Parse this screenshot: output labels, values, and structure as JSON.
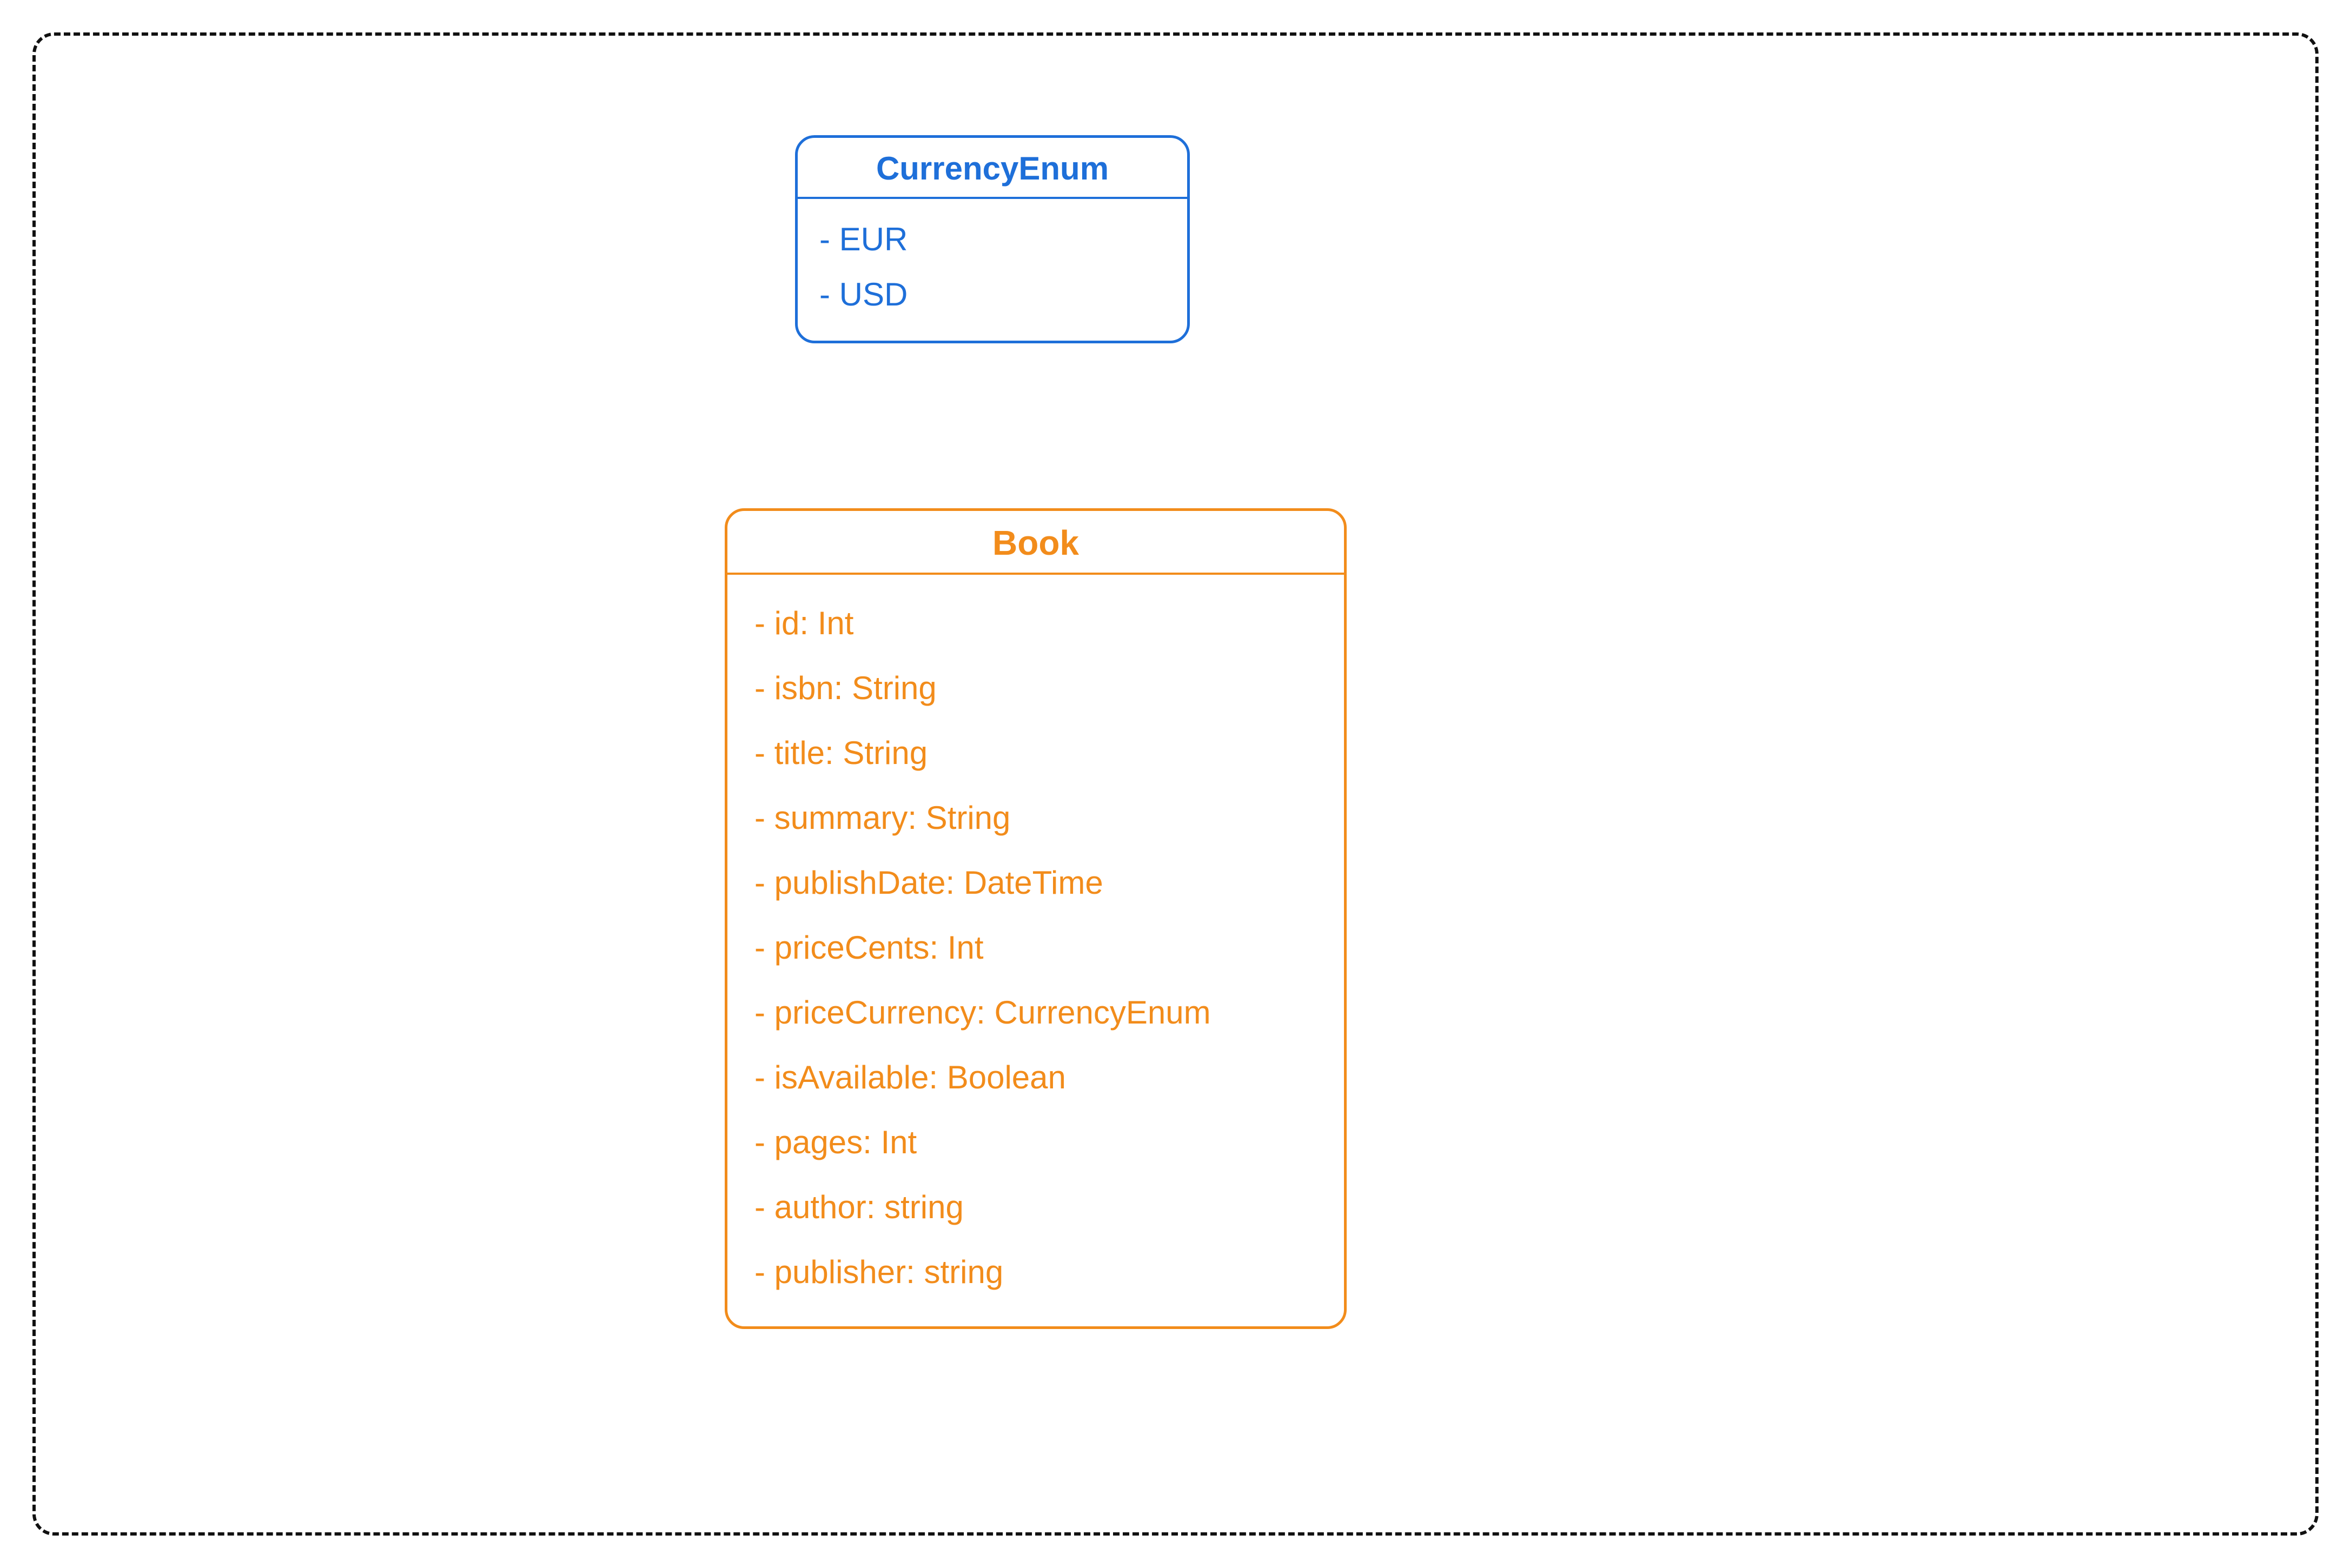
{
  "enum": {
    "name": "CurrencyEnum",
    "items": [
      "- EUR",
      "- USD"
    ],
    "color": "#1e6fd9"
  },
  "class": {
    "name": "Book",
    "fields": [
      "- id: Int",
      "- isbn: String",
      "- title: String",
      "- summary: String",
      "- publishDate: DateTime",
      "- priceCents: Int",
      "- priceCurrency: CurrencyEnum",
      "- isAvailable: Boolean",
      "- pages: Int",
      "- author: string",
      "- publisher: string"
    ],
    "color": "#f28c1b"
  }
}
